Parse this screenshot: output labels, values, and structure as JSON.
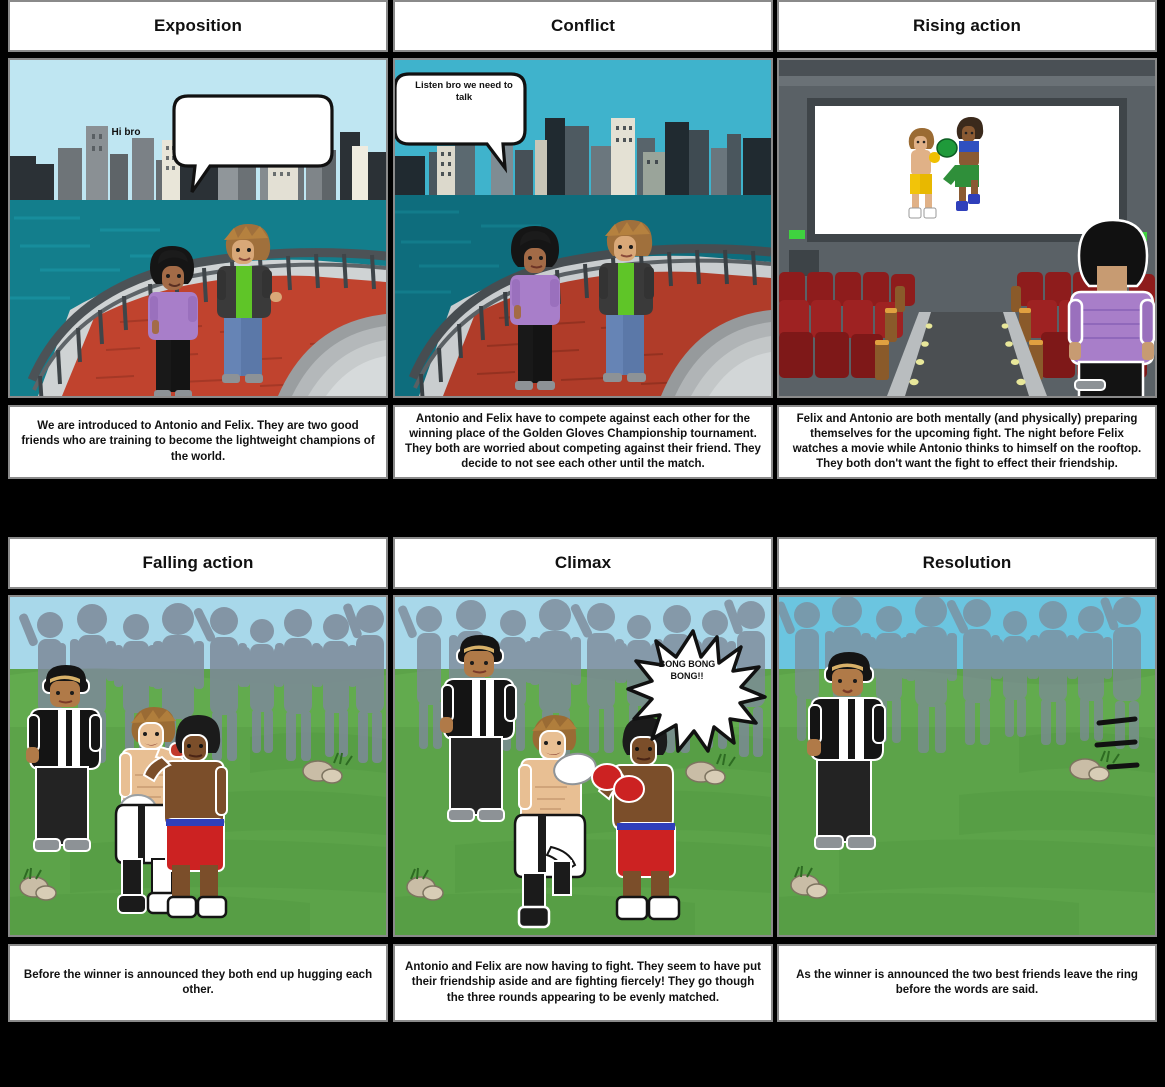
{
  "storyboard": {
    "background_color": "#000000",
    "card_border_color": "#8a8a8a",
    "card_background": "#ffffff",
    "rows": [
      {
        "cells": [
          {
            "title": "Exposition",
            "caption": "We are introduced to Antonio and Felix. They are two good friends who are training to become the lightweight champions of the world.",
            "scene": "waterfront-day",
            "speech_bubble": {
              "text": "Hi bro",
              "style": "rounded",
              "tail": "bottom-left"
            },
            "colors": {
              "sky": "#bfe6f2",
              "water": "#137e8c",
              "walkway": "#c0432e",
              "steps": "#b8bcbd"
            }
          },
          {
            "title": "Conflict",
            "caption": "Antonio and Felix have to compete against each other for the winning place of the Golden Gloves Championship tournament. They both are worried about competing against their friend. They decide to not see each other until the match.",
            "scene": "waterfront-dusk",
            "speech_bubble": {
              "text": "Listen bro we need to talk",
              "style": "rounded",
              "tail": "bottom-right"
            },
            "colors": {
              "sky": "#3fb3cc",
              "water": "#0e6d7d",
              "walkway": "#b03c29",
              "steps": "#b8bcbd"
            }
          },
          {
            "title": "Rising action",
            "caption": "Felix and Antonio are both mentally (and physically) preparing themselves for the upcoming fight. The night before Felix watches a movie while Antonio thinks to himself on the rooftop. They both don't want the fight to effect their friendship.",
            "scene": "cinema",
            "speech_bubble": null,
            "colors": {
              "wall": "#5a6166",
              "screen": "#ffffff",
              "seats": "#8e1c1c",
              "aisle": "#4b4f52",
              "exit_light": "#3fd23f"
            }
          }
        ]
      },
      {
        "cells": [
          {
            "title": "Falling action",
            "caption": "Before the winner is announced they both end up hugging each other.",
            "scene": "field-hug",
            "speech_bubble": null,
            "colors": {
              "sky": "#a8d8ea",
              "grass": "#5ca349",
              "crowd": "#7d8a99",
              "ref_shirt": "#ffffff"
            }
          },
          {
            "title": "Climax",
            "caption": "Antonio and Felix are now having to fight. They seem to have put their friendship aside and are fighting fiercely! They go though the three rounds appearing to be evenly matched.",
            "scene": "field-fight",
            "speech_bubble": {
              "text": "BONG BONG BONG!!",
              "style": "burst",
              "tail": "none"
            },
            "colors": {
              "sky": "#a8d8ea",
              "grass": "#5ca349",
              "crowd": "#7d8a99",
              "glove_red": "#cc2222"
            }
          },
          {
            "title": "Resolution",
            "caption": "As the winner is announced the two best friends leave the ring before the words are said.",
            "scene": "field-empty",
            "speech_bubble": null,
            "colors": {
              "sky": "#6bc5e0",
              "grass": "#5ca349",
              "crowd": "#7d8a99",
              "motion_lines": "#111111"
            }
          }
        ]
      }
    ]
  }
}
